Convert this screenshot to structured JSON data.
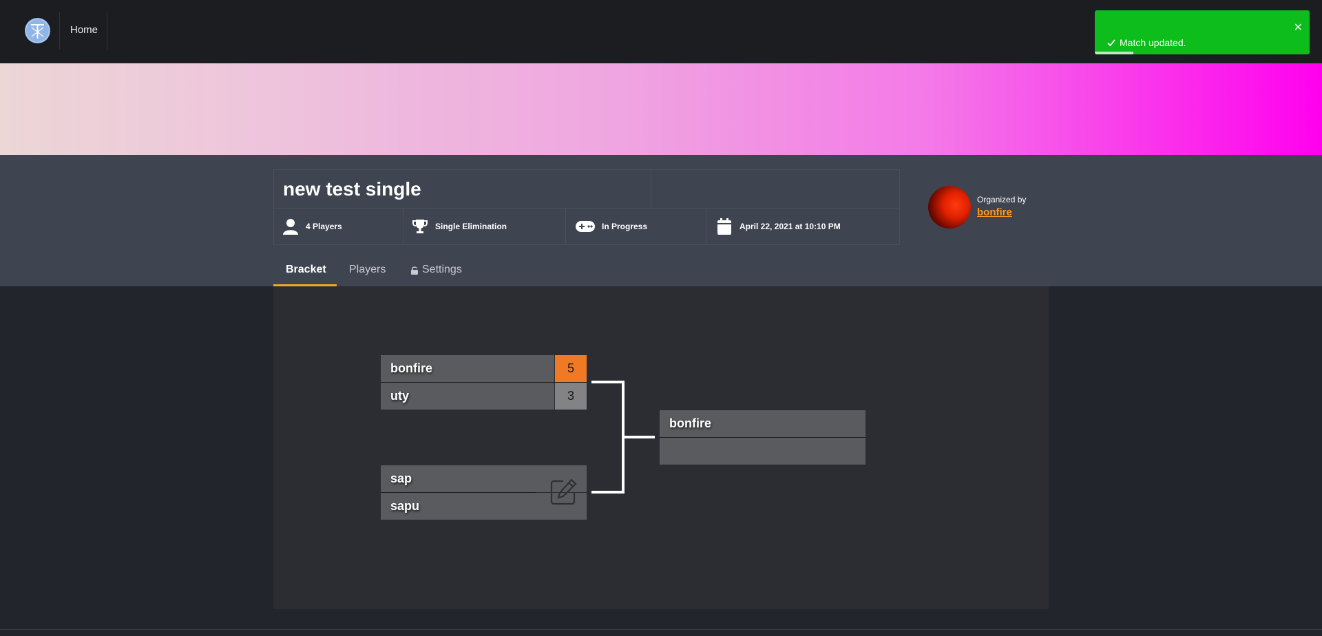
{
  "nav": {
    "logo": "tournament-logo",
    "home_label": "Home"
  },
  "toast": {
    "message": "Match updated.",
    "close_glyph": "✕",
    "progress": 0.18,
    "color": "#0cbd1b"
  },
  "banner": {
    "gradient_start": "#ecd6d6",
    "gradient_end": "#ff00ee"
  },
  "tournament": {
    "title": "new test single",
    "players": "4 Players",
    "format": "Single Elimination",
    "status": "In Progress",
    "date": "April 22, 2021 at 10:10 PM"
  },
  "organizer": {
    "label": "Organized by",
    "name": "bonfire"
  },
  "tabs": {
    "bracket": "Bracket",
    "players": "Players",
    "settings": "Settings"
  },
  "bracket": {
    "round1": [
      {
        "top": {
          "name": "bonfire",
          "score": "5",
          "winner": true
        },
        "bottom": {
          "name": "uty",
          "score": "3",
          "winner": false
        }
      },
      {
        "top": {
          "name": "sap"
        },
        "bottom": {
          "name": "sapu"
        }
      }
    ],
    "final": {
      "top": {
        "name": "bonfire"
      },
      "bottom": {
        "name": ""
      }
    }
  },
  "colors": {
    "accent": "#f5a623",
    "win_score": "#f07a23",
    "lose_score": "#838386",
    "organizer_link": "#ff9a1e"
  }
}
